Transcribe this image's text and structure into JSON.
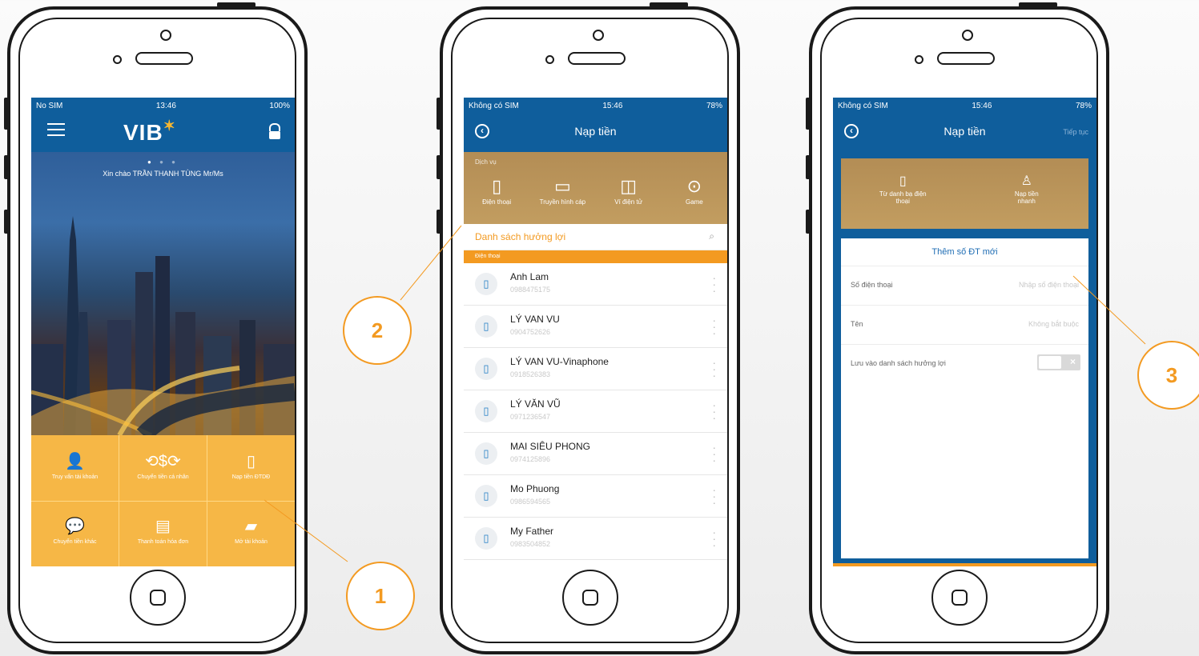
{
  "colors": {
    "brand_blue": "#0f5e9c",
    "accent_orange": "#f39a21",
    "gold": "#b08b4f"
  },
  "callouts": [
    "1",
    "2",
    "3"
  ],
  "phone1": {
    "status": {
      "carrier": "No SIM",
      "time": "13:46",
      "battery": "100%"
    },
    "logo": "VIB",
    "greeting": "Xin chào TRẦN THANH TÙNG Mr/Ms",
    "tiles": [
      {
        "label": "Truy vấn tài khoản",
        "icon": "person-icon"
      },
      {
        "label": "Chuyển tiền cá nhân",
        "icon": "money-transfer-icon"
      },
      {
        "label": "Nạp tiền ĐTDĐ",
        "icon": "phone-icon"
      },
      {
        "label": "Chuyển tiền khác",
        "icon": "chat-transfer-icon"
      },
      {
        "label": "Thanh toán hóa đơn",
        "icon": "bill-icon"
      },
      {
        "label": "Mở tài khoản",
        "icon": "folder-icon"
      }
    ]
  },
  "phone2": {
    "status": {
      "carrier": "Không có SIM",
      "time": "15:46",
      "battery": "78%"
    },
    "title": "Nạp tiền",
    "services_label": "Dịch vụ",
    "services": [
      {
        "label": "Điện thoại",
        "icon": "phone-icon"
      },
      {
        "label": "Truyền hình cáp",
        "icon": "tv-icon"
      },
      {
        "label": "Ví điện tử",
        "icon": "wallet-icon"
      },
      {
        "label": "Game",
        "icon": "gamepad-icon"
      }
    ],
    "beneficiary_title": "Danh sách hưởng lợi",
    "section_label": "Điện thoại",
    "contacts": [
      {
        "name": "Anh Lam",
        "phone": "0988475175"
      },
      {
        "name": "LÝ VAN VU",
        "phone": "0904752626"
      },
      {
        "name": "LÝ VAN VU-Vinaphone",
        "phone": "0918526383"
      },
      {
        "name": "LÝ VĂN VŨ",
        "phone": "0971236547"
      },
      {
        "name": "MAI SIÊU PHONG",
        "phone": "0974125896"
      },
      {
        "name": "Mo Phuong",
        "phone": "0986594565"
      },
      {
        "name": "My Father",
        "phone": "0983504852"
      }
    ]
  },
  "phone3": {
    "status": {
      "carrier": "Không có SIM",
      "time": "15:46",
      "battery": "78%"
    },
    "title": "Nạp tiền",
    "next_label": "Tiếp tục",
    "options": [
      {
        "label": "Từ danh bạ điện thoại",
        "icon": "contacts-book-icon"
      },
      {
        "label": "Nạp tiền nhanh",
        "icon": "person-icon"
      }
    ],
    "form_title": "Thêm số ĐT mới",
    "fields": [
      {
        "label": "Số điện thoại",
        "placeholder": "Nhập số điện thoại"
      },
      {
        "label": "Tên",
        "placeholder": "Không bắt buộc"
      }
    ],
    "save_label": "Lưu vào danh sách hưởng lợi"
  }
}
